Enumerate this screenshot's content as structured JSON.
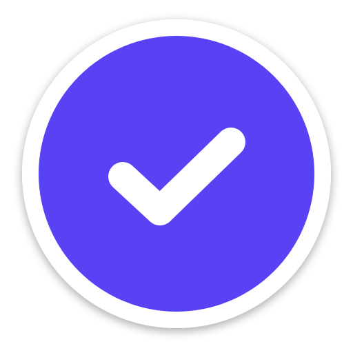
{
  "icon": {
    "name": "checkmark-badge-icon",
    "colors": {
      "outer_ring": "#ffffff",
      "fill": "#5842F4",
      "check": "#ffffff",
      "shadow": "#000000"
    }
  }
}
